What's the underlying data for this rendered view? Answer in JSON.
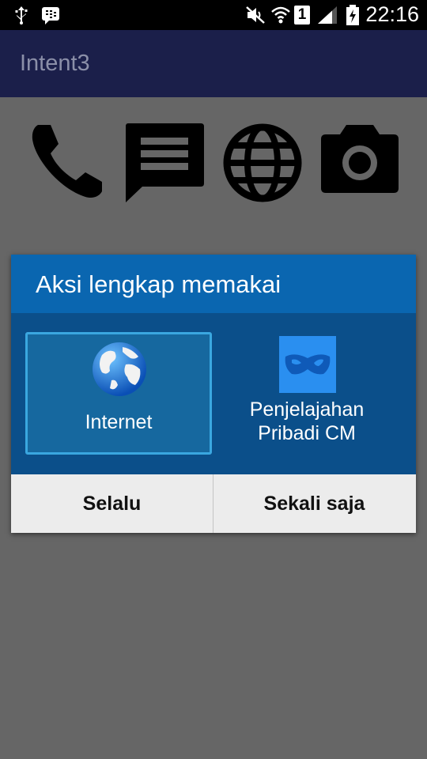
{
  "status_bar": {
    "time": "22:16",
    "sim_badge": "1",
    "icons": [
      "usb-icon",
      "bbm-icon",
      "mute-icon",
      "wifi-icon",
      "sim-1-icon",
      "signal-icon",
      "battery-charging-icon"
    ]
  },
  "app": {
    "title": "Intent3"
  },
  "content": {
    "icons": [
      "phone-icon",
      "message-icon",
      "globe-icon",
      "camera-icon"
    ]
  },
  "dialog": {
    "title": "Aksi lengkap memakai",
    "choices": [
      {
        "label": "Internet",
        "icon": "internet-globe-icon",
        "selected": true
      },
      {
        "label_line1": "Penjelajahan",
        "label_line2": "Pribadi CM",
        "icon": "cm-mask-icon",
        "selected": false
      }
    ],
    "buttons": {
      "always": "Selalu",
      "once": "Sekali saja"
    }
  },
  "colors": {
    "background": "#666666",
    "app_bar": "#1b1f4a",
    "dialog_header": "#0a66b0",
    "dialog_body": "#0b4f8a",
    "selected_border": "#3aa7e0",
    "footer": "#ececec"
  }
}
